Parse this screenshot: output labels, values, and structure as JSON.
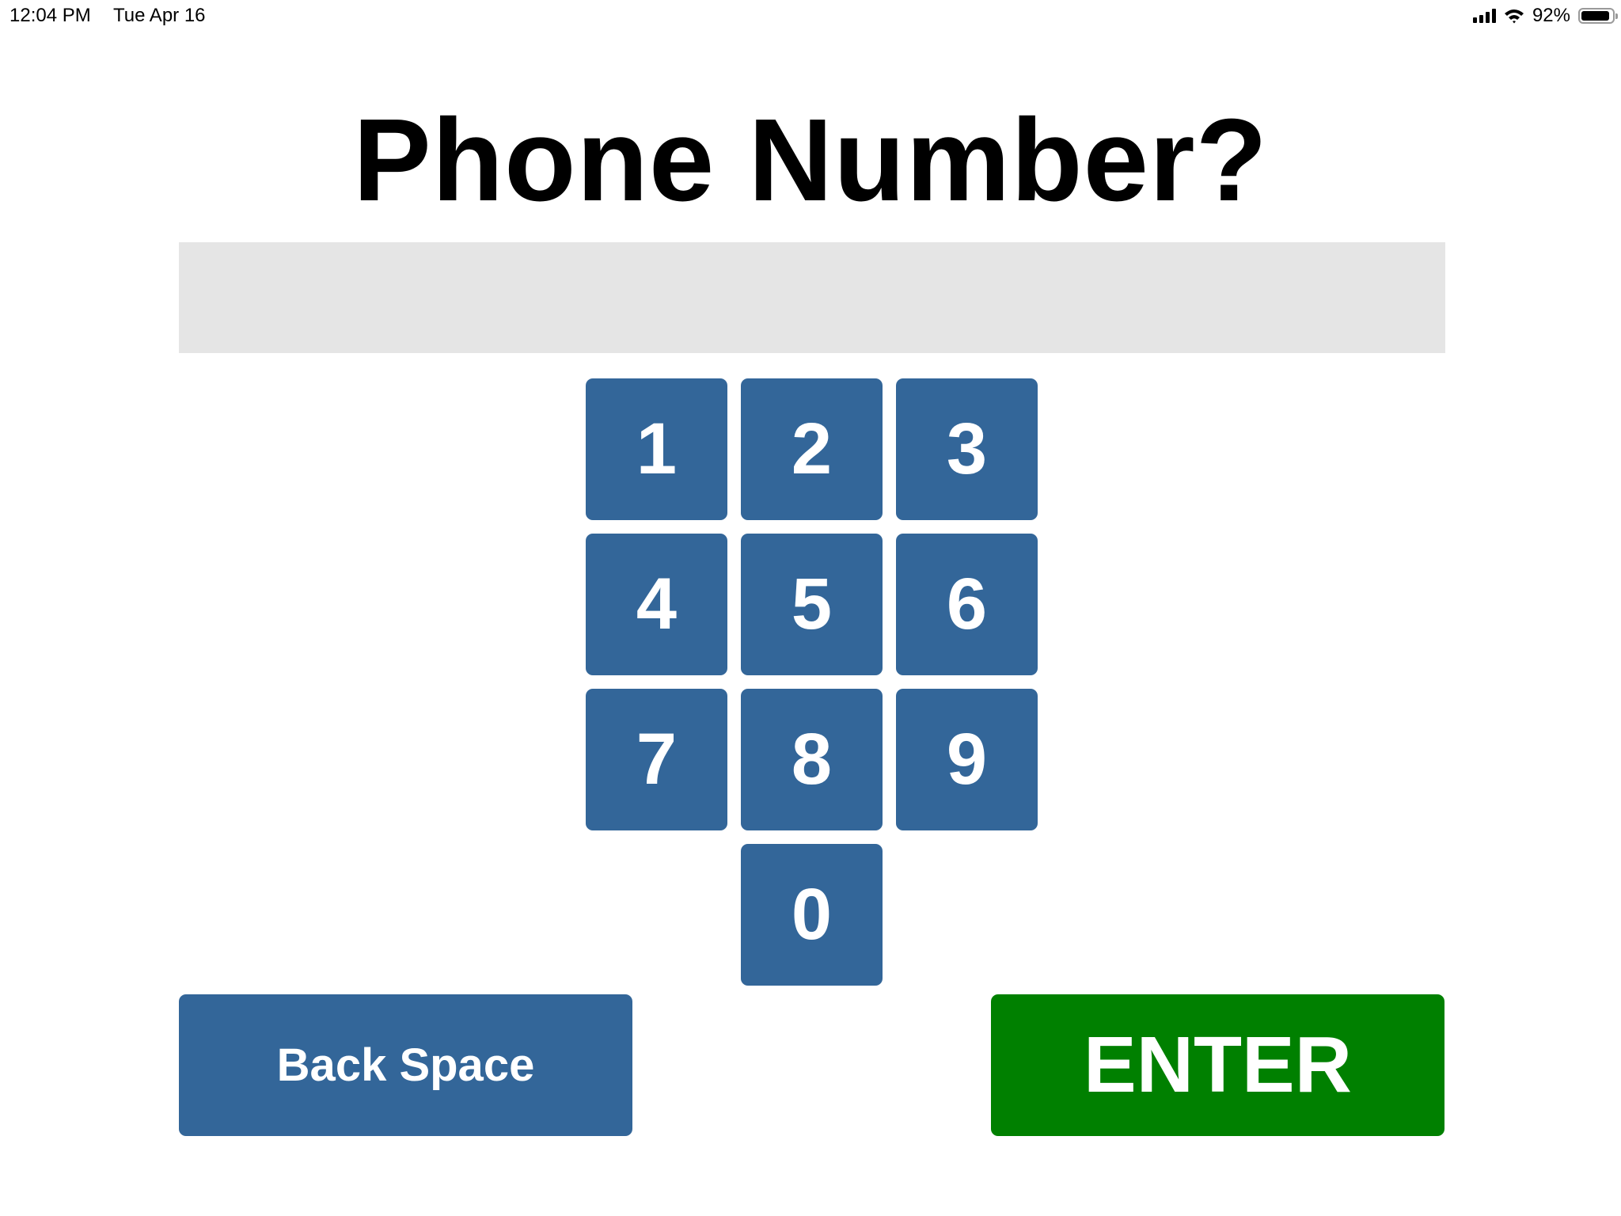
{
  "status_bar": {
    "time": "12:04 PM",
    "date": "Tue Apr 16",
    "battery_percent": "92%",
    "battery_level": 0.92,
    "icons": [
      "cellular-signal-icon",
      "wifi-icon",
      "battery-icon"
    ]
  },
  "page": {
    "title": "Phone Number?"
  },
  "phone_input": {
    "value": "",
    "placeholder": ""
  },
  "keypad": {
    "keys": [
      "1",
      "2",
      "3",
      "4",
      "5",
      "6",
      "7",
      "8",
      "9",
      "0"
    ]
  },
  "actions": {
    "backspace_label": "Back Space",
    "enter_label": "ENTER"
  },
  "colors": {
    "key_blue": "#336699",
    "enter_green": "#008000",
    "input_gray": "#e5e5e5"
  }
}
